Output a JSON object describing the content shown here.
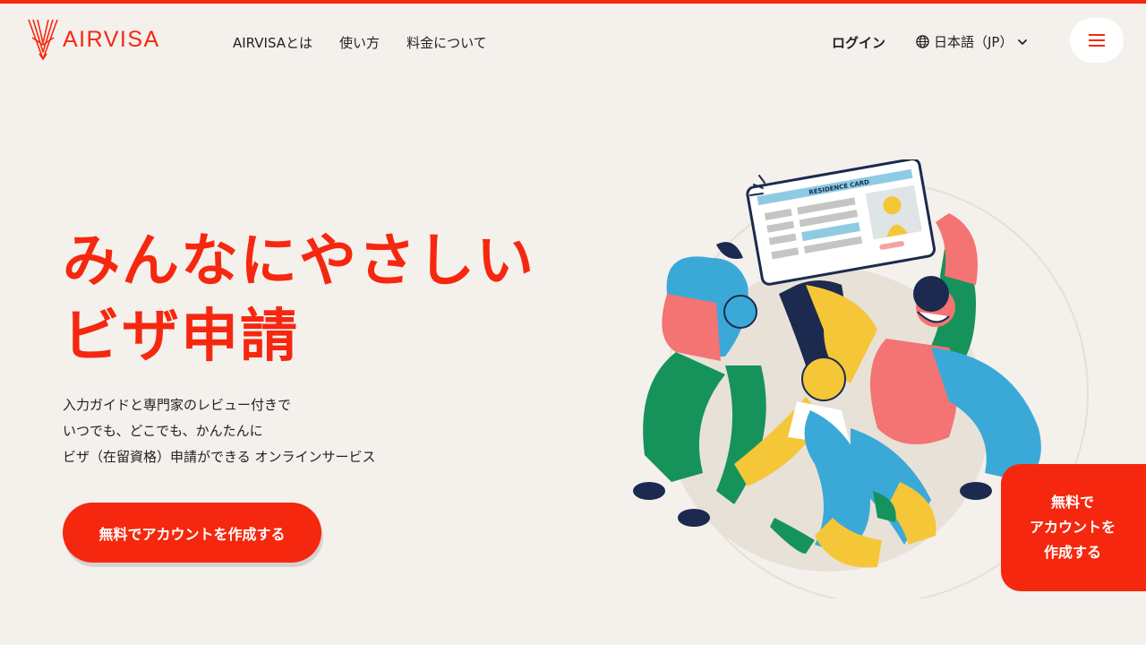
{
  "header": {
    "logo_text": "AIRVISA",
    "nav": [
      "AIRVISAとは",
      "使い方",
      "料金について"
    ],
    "login": "ログイン",
    "language": "日本語（JP）"
  },
  "hero": {
    "title_line1": "みんなにやさしい",
    "title_line2": "ビザ申請",
    "description": [
      "入力ガイドと専門家のレビュー付きで",
      "いつでも、どこでも、かんたんに",
      "ビザ（在留資格）申請ができる オンラインサービス"
    ],
    "cta": "無料でアカウントを作成する"
  },
  "illustration": {
    "card_title": "RESIDENCE CARD"
  },
  "floating_cta": [
    "無料で",
    "アカウントを",
    "作成する"
  ],
  "colors": {
    "brand_red": "#f5280f",
    "background": "#f4f0ec"
  },
  "icons": [
    "airvisa-logo-icon",
    "globe-icon",
    "chevron-down-icon",
    "hamburger-menu-icon"
  ]
}
